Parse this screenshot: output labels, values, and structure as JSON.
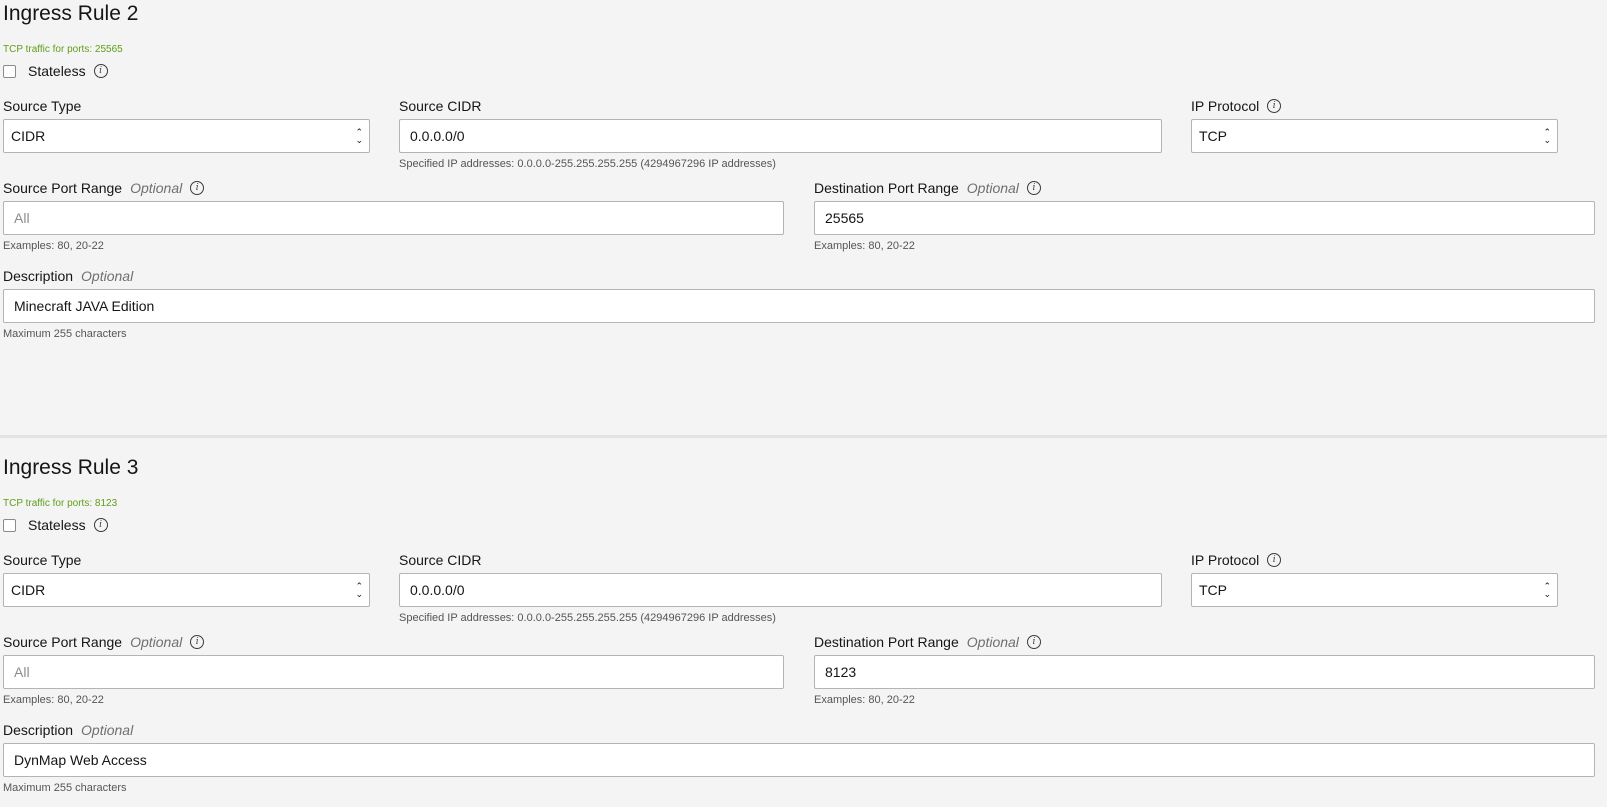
{
  "rules": [
    {
      "title": "Ingress Rule 2",
      "summary": "TCP traffic for ports: 25565",
      "stateless_label": "Stateless",
      "source_type": {
        "label": "Source Type",
        "value": "CIDR"
      },
      "source_cidr": {
        "label": "Source CIDR",
        "value": "0.0.0.0/0",
        "helper": "Specified IP addresses: 0.0.0.0-255.255.255.255 (4294967296 IP addresses)"
      },
      "ip_protocol": {
        "label": "IP Protocol",
        "value": "TCP"
      },
      "source_port": {
        "label": "Source Port Range",
        "optional": "Optional",
        "placeholder": "All",
        "helper": "Examples: 80, 20-22"
      },
      "dest_port": {
        "label": "Destination Port Range",
        "optional": "Optional",
        "value": "25565",
        "helper": "Examples: 80, 20-22"
      },
      "description": {
        "label": "Description",
        "optional": "Optional",
        "value": "Minecraft JAVA Edition",
        "helper": "Maximum 255 characters"
      }
    },
    {
      "title": "Ingress Rule 3",
      "summary": "TCP traffic for ports: 8123",
      "stateless_label": "Stateless",
      "source_type": {
        "label": "Source Type",
        "value": "CIDR"
      },
      "source_cidr": {
        "label": "Source CIDR",
        "value": "0.0.0.0/0",
        "helper": "Specified IP addresses: 0.0.0.0-255.255.255.255 (4294967296 IP addresses)"
      },
      "ip_protocol": {
        "label": "IP Protocol",
        "value": "TCP"
      },
      "source_port": {
        "label": "Source Port Range",
        "optional": "Optional",
        "placeholder": "All",
        "helper": "Examples: 80, 20-22"
      },
      "dest_port": {
        "label": "Destination Port Range",
        "optional": "Optional",
        "value": "8123",
        "helper": "Examples: 80, 20-22"
      },
      "description": {
        "label": "Description",
        "optional": "Optional",
        "value": "DynMap Web Access",
        "helper": "Maximum 255 characters"
      }
    }
  ],
  "icons": {
    "info": "info-icon",
    "select": "chevron-up-down-icon"
  },
  "colors": {
    "summary": "#5f9f1a",
    "background": "#f4f4f4",
    "border": "#b4b4b4"
  }
}
